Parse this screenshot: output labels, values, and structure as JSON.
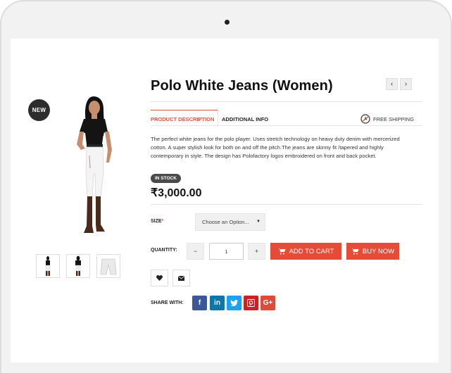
{
  "product": {
    "badge": "NEW",
    "title": "Polo White Jeans (Women)",
    "nav": {
      "prev": "‹",
      "next": "›"
    },
    "tabs": [
      {
        "label": "PRODUCT DESCRIPTION",
        "active": true
      },
      {
        "label": "ADDITIONAL INFO",
        "active": false
      }
    ],
    "shipping_label": "FREE SHIPPING",
    "description": "The perfect white jeans for the polo player. Uses stretch technology on heavy duty denim with mercerized cotton. A super stylish look for both on and off the pitch.The jeans are skinny fit /tapered and highly contemporary in style. The design has Polofactory logos embroidered on front and back pocket.",
    "stock_status": "IN STOCK",
    "price": "₹3,000.00",
    "size_label": "SIZE",
    "size_required_mark": "*",
    "size_placeholder": "Choose an Option...",
    "quantity_label": "QUANTITY:",
    "quantity_value": "1",
    "quantity_minus": "−",
    "quantity_plus": "+",
    "add_to_cart_label": "ADD TO CART",
    "buy_now_label": "BUY NOW",
    "share_label": "SHARE WITH:",
    "social": [
      {
        "name": "facebook",
        "glyph": "f",
        "color": "#3b5998"
      },
      {
        "name": "linkedin",
        "glyph": "in",
        "color": "#0e76a8"
      },
      {
        "name": "twitter",
        "glyph": "t",
        "color": "#1da1f2"
      },
      {
        "name": "pinterest",
        "glyph": "P",
        "color": "#cb2027"
      },
      {
        "name": "googleplus",
        "glyph": "G+",
        "color": "#dd4b39"
      }
    ]
  },
  "colors": {
    "accent": "#e64b37",
    "dark": "#2d2d2d"
  }
}
